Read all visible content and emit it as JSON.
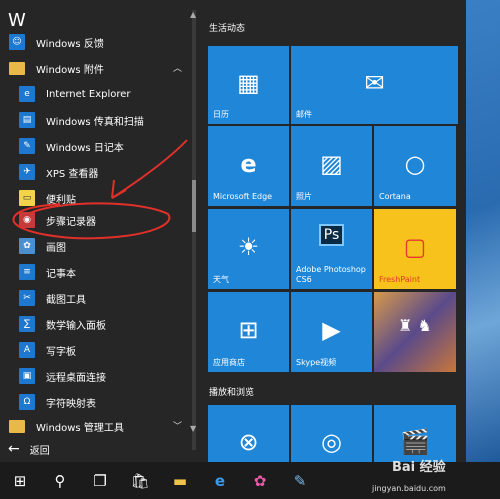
{
  "app_list": {
    "section_letter": "W",
    "items": [
      {
        "label": "Windows 反馈",
        "icon": "person-feedback-icon"
      },
      {
        "label": "Windows 附件",
        "icon": "folder-icon"
      },
      {
        "label": "Internet Explorer",
        "icon": "internet-explorer-icon"
      },
      {
        "label": "Windows 传真和扫描",
        "icon": "fax-scan-icon"
      },
      {
        "label": "Windows 日记本",
        "icon": "journal-icon"
      },
      {
        "label": "XPS 查看器",
        "icon": "xps-viewer-icon"
      },
      {
        "label": "便利贴",
        "icon": "sticky-notes-icon"
      },
      {
        "label": "步骤记录器",
        "icon": "steps-recorder-icon"
      },
      {
        "label": "画图",
        "icon": "paint-icon"
      },
      {
        "label": "记事本",
        "icon": "notepad-icon"
      },
      {
        "label": "截图工具",
        "icon": "snipping-tool-icon"
      },
      {
        "label": "数学输入面板",
        "icon": "math-input-icon"
      },
      {
        "label": "写字板",
        "icon": "wordpad-icon"
      },
      {
        "label": "远程桌面连接",
        "icon": "remote-desktop-icon"
      },
      {
        "label": "字符映射表",
        "icon": "character-map-icon"
      },
      {
        "label": "Windows 管理工具",
        "icon": "folder-icon"
      }
    ],
    "back_label": "返回"
  },
  "tiles": {
    "group1_title": "生活动态",
    "group2_title": "播放和浏览",
    "items": [
      {
        "label": "日历",
        "icon": "calendar-icon",
        "color": "#1f86d8"
      },
      {
        "label": "邮件",
        "icon": "mail-icon",
        "color": "#1f86d8"
      },
      {
        "label": "Microsoft Edge",
        "icon": "edge-icon",
        "color": "#1f86d8"
      },
      {
        "label": "照片",
        "icon": "photos-icon",
        "color": "#1f86d8"
      },
      {
        "label": "Cortana",
        "icon": "cortana-icon",
        "color": "#1f86d8"
      },
      {
        "label": "天气",
        "icon": "weather-sun-icon",
        "color": "#1f86d8"
      },
      {
        "label": "Adobe Photoshop CS6",
        "icon": "photoshop-icon",
        "color": "#1f86d8"
      },
      {
        "label": "FreshPaint",
        "icon": "freshpaint-icon",
        "color": "#f6c21b"
      },
      {
        "label": "应用商店",
        "icon": "store-icon",
        "color": "#1f86d8"
      },
      {
        "label": "Skype视频",
        "icon": "skype-video-icon",
        "color": "#1f86d8"
      },
      {
        "label": "",
        "icon": "game-art-icon",
        "color": "#b58a4c"
      },
      {
        "label": "",
        "icon": "xbox-icon",
        "color": "#1f86d8"
      },
      {
        "label": "",
        "icon": "groove-music-icon",
        "color": "#1f86d8"
      },
      {
        "label": "",
        "icon": "movies-tv-icon",
        "color": "#1f86d8"
      }
    ]
  },
  "taskbar": {
    "items": [
      "start-icon",
      "search-icon",
      "task-view-icon",
      "store-icon",
      "file-explorer-icon",
      "edge-icon",
      "photos-app-icon",
      "paint-icon"
    ]
  },
  "watermark": {
    "brand": "Bai 经验",
    "url": "jingyan.baidu.com"
  }
}
